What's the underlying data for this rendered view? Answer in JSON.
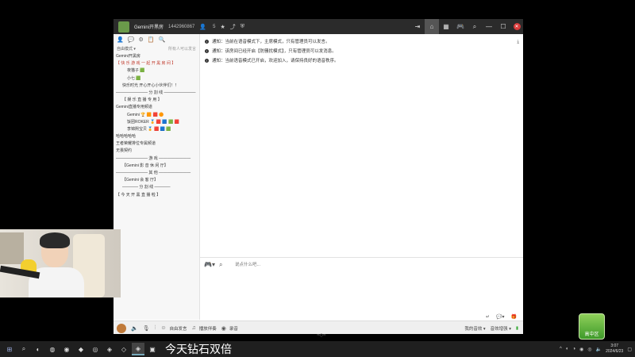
{
  "window": {
    "name": "Gemini开黑房",
    "id": "1442960867",
    "online": "5"
  },
  "sidebar": {
    "tabs": [
      "👤",
      "💬",
      "⚙",
      "📋",
      "🔍"
    ],
    "mode": "自由模式 ▾",
    "mode_right": "所有人可以发言",
    "tree": [
      {
        "label": "Gemini开黑房",
        "level": 0
      },
      {
        "label": "【 快 乐 游 戏 一 起 开 黑 房 间 】",
        "level": 0,
        "red": true
      },
      {
        "label": "夜猫子 🟩",
        "level": 1
      },
      {
        "label": "小七 🟩",
        "level": 1
      },
      {
        "label": "快乐时光 开心开心小伙伴们！！",
        "level": 1
      },
      {
        "label": "———————— 分 割 线 ————————",
        "level": 0
      },
      {
        "label": "【 娱 乐 直 播 专 用 】",
        "level": 1
      },
      {
        "label": "Gemini直播专用频道",
        "level": 0
      },
      {
        "label": "Gemini 🏆 🟧 🟥 🟠",
        "level": 2
      },
      {
        "label": "饭团ROKER 🏅 🟥 🟦 🟩 🟥",
        "level": 2
      },
      {
        "label": "李锦熙宝贝 🏅 🟥 🟦 🟩",
        "level": 2
      },
      {
        "label": "哈哈哈哈哈",
        "level": 0
      },
      {
        "label": "王者荣耀排位专属频道",
        "level": 0
      },
      {
        "label": "无畏契约",
        "level": 0
      },
      {
        "label": "———————— 游 戏 ————————",
        "level": 0
      },
      {
        "label": "【Gemini 影 音 休 闲 厅】",
        "level": 1
      },
      {
        "label": "———————— 其 他 ————————",
        "level": 0
      },
      {
        "label": "【Gemini 会 客 厅】",
        "level": 1
      },
      {
        "label": "———— 分 割 线 ————",
        "level": 1
      },
      {
        "label": "【 今 天 开 黑 直 播 啦 】",
        "level": 0
      }
    ]
  },
  "messages": [
    "通知：当前在语音模式下，主席模式，只有管理员可以发言。",
    "通知：该房间已经开启【防骚扰模式】，只有管理员可以发消息。",
    "通知：当前语音模式已开启，欢迎加入，请保持良好的语音秩序。"
  ],
  "input": {
    "placeholder": "说点什么吧..."
  },
  "bottombar": {
    "items": [
      "自由发言",
      "播放伴奏",
      "录音"
    ],
    "right": [
      "我的音效 ▾",
      "音效增强 ▾"
    ]
  },
  "taskbar": {
    "label": "今天钻石双倍",
    "time": "3:07",
    "date": "2024/6/23"
  },
  "badge": {
    "text": "高中区"
  },
  "colors": {
    "titlebar": "#2b2b2b",
    "accent_red": "#c0392b"
  }
}
